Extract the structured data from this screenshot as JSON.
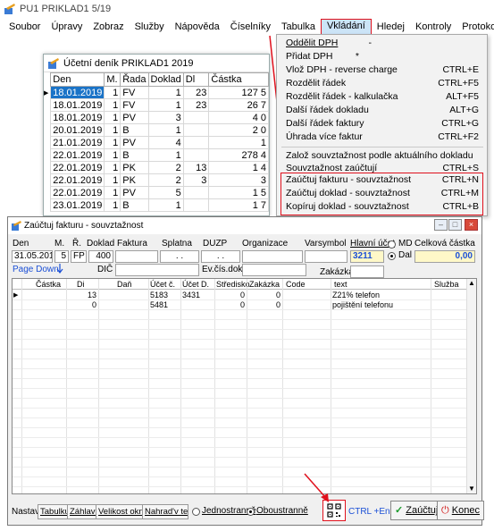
{
  "app": {
    "title": "PU1 PRIKLAD1 5/19"
  },
  "menubar": [
    "Soubor",
    "Úpravy",
    "Zobraz",
    "Služby",
    "Nápověda",
    "Číselníky",
    "Tabulka",
    "Vkládání",
    "Hledej",
    "Kontroly",
    "Protokol"
  ],
  "journal": {
    "title": "Účetní deník  PRIKLAD1    2019",
    "columns": [
      "Den",
      "M.",
      "Řada",
      "Doklad",
      "Dl",
      "Částka"
    ],
    "rows": [
      [
        "18.01.2019",
        "1",
        "FV",
        "1",
        "23",
        "127 5"
      ],
      [
        "18.01.2019",
        "1",
        "FV",
        "1",
        "23",
        "26 7"
      ],
      [
        "18.01.2019",
        "1",
        "PV",
        "3",
        "",
        "4 0"
      ],
      [
        "20.01.2019",
        "1",
        "B",
        "1",
        "",
        "2 0"
      ],
      [
        "21.01.2019",
        "1",
        "PV",
        "4",
        "",
        "1"
      ],
      [
        "22.01.2019",
        "1",
        "B",
        "1",
        "",
        "278 4"
      ],
      [
        "22.01.2019",
        "1",
        "PK",
        "2",
        "13",
        "1 4"
      ],
      [
        "22.01.2019",
        "1",
        "PK",
        "2",
        "3",
        "3"
      ],
      [
        "22.01.2019",
        "1",
        "PV",
        "5",
        "",
        "1 5"
      ],
      [
        "23.01.2019",
        "1",
        "B",
        "1",
        "",
        "1 7"
      ]
    ]
  },
  "dropdown": {
    "items": [
      {
        "label": "Oddělit DPH",
        "shortcut": "-"
      },
      {
        "label": "Přidat DPH",
        "shortcut": "*"
      },
      {
        "label": "Vlož DPH - reverse charge",
        "shortcut": "CTRL+E"
      },
      {
        "label": "Rozdělit řádek",
        "shortcut": "CTRL+F5"
      },
      {
        "label": "Rozdělit řádek - kalkulačka",
        "shortcut": "ALT+F5"
      },
      {
        "label": "Další řádek dokladu",
        "shortcut": "ALT+G"
      },
      {
        "label": "Další řádek faktury",
        "shortcut": "CTRL+G"
      },
      {
        "label": "Úhrada více faktur",
        "shortcut": "CTRL+F2"
      },
      {
        "label": "Založ souvztažnost podle aktuálního dokladu",
        "shortcut": ""
      },
      {
        "label": "Souvztažnost zaúčtují",
        "shortcut": "CTRL+S"
      },
      {
        "label": "Zaúčtuj fakturu - souvztažnost",
        "shortcut": "CTRL+N"
      },
      {
        "label": "Zaúčtuj doklad - souvztažnost",
        "shortcut": "CTRL+M"
      },
      {
        "label": "Kopíruj doklad - souvztažnost",
        "shortcut": "CTRL+B"
      }
    ]
  },
  "dialog": {
    "title": "Zaúčtuj fakturu - souvztažnost",
    "header": {
      "labels": {
        "den": "Den",
        "m": "M.",
        "r": "Ř.",
        "doklad": "Doklad",
        "faktura": "Faktura",
        "splatna": "Splatna",
        "duzp": "DUZP",
        "organizace": "Organizace",
        "varsymbol": "Varsymbol",
        "hlavni_ucet": "Hlavní účet",
        "md": "MD",
        "dal": "Dal",
        "celkova_castka": "Celková částka",
        "page_down": "Page Down:",
        "dic": "DIČ",
        "ev_cis_dokl": "Ev.čís.dokl",
        "zakazka": "Zakázka"
      },
      "values": {
        "den": "31.05.2019",
        "m": "5",
        "r": "FP",
        "doklad": "400",
        "faktura": "",
        "splatna": " .  . ",
        "duzp": " .  . ",
        "organizace": "",
        "varsymbol": "",
        "hlavni_ucet": "3211",
        "celkova_castka": "0,00",
        "dic": "",
        "ev_cis_dokl": "",
        "zakazka": ""
      }
    },
    "grid": {
      "columns": [
        "Částka",
        "Di",
        "Daň",
        "Účet č.",
        "Účet D.",
        "Středisko",
        "Zakázka",
        "Code",
        "text",
        "Služba"
      ],
      "rows": [
        [
          "",
          "13",
          "",
          "5183",
          "3431",
          "0",
          "0",
          "",
          "Z21% telefon",
          ""
        ],
        [
          "",
          "0",
          "",
          "5481",
          "",
          "0",
          "0",
          "",
          "pojištění telefonu",
          ""
        ]
      ]
    },
    "footer": {
      "nastav": "Nastav:",
      "buttons": [
        "Tabulku",
        "Záhlaví",
        "Velikost okna",
        "Nahrad'v textu"
      ],
      "radio1": "Jednostranně",
      "radio2": "Oboustranně",
      "hint": "CTRL +Enter",
      "zauctuj": "Zaúčtuj",
      "konec": "Konec"
    }
  },
  "colors": {
    "accent": "#e0101c",
    "selection": "#1a73c7",
    "link": "#1a4fd6"
  }
}
